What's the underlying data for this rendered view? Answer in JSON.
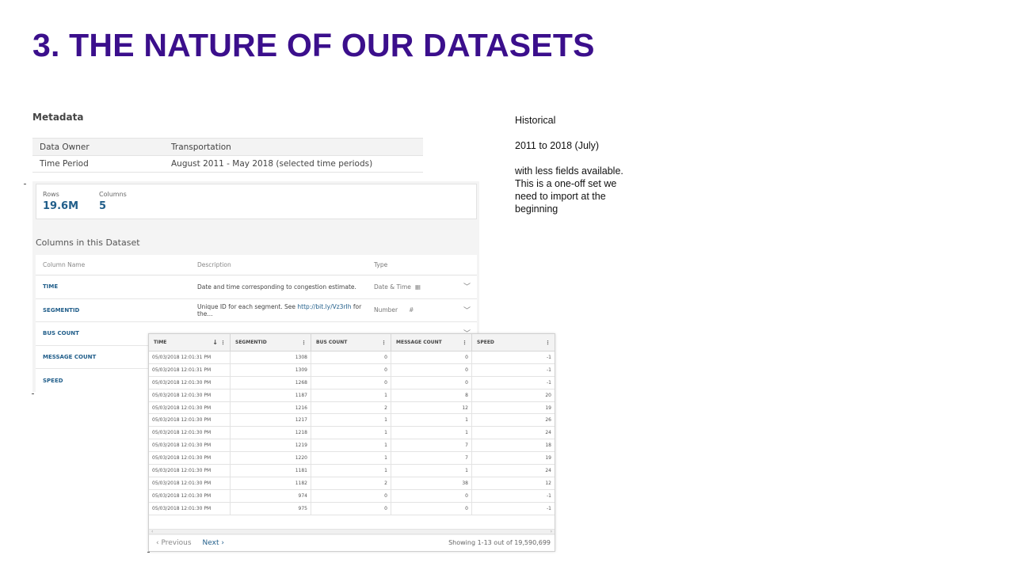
{
  "slide": {
    "title": "3. THE NATURE OF OUR DATASETS"
  },
  "notes": {
    "line1": "Historical",
    "line2": "2011 to 2018 (July)",
    "line3": "with less fields available.  This is a one-off set we need to import at the beginning"
  },
  "metadata": {
    "heading": "Metadata",
    "rows": [
      {
        "key": "Data Owner",
        "value": "Transportation"
      },
      {
        "key": "Time Period",
        "value": "August 2011 - May 2018 (selected time periods)"
      }
    ]
  },
  "stats": {
    "rows_label": "Rows",
    "rows_value": "19.6M",
    "columns_label": "Columns",
    "columns_value": "5"
  },
  "columns_section": {
    "heading": "Columns in this Dataset",
    "headers": {
      "name": "Column Name",
      "description": "Description",
      "type": "Type"
    },
    "rows": [
      {
        "name": "TIME",
        "description": "Date and time corresponding to congestion estimate.",
        "type": "Date & Time",
        "icon": "calendar-icon"
      },
      {
        "name": "SEGMENTID",
        "description_pre": "Unique ID for each segment. See ",
        "link": "http://bit.ly/Vz3rIh",
        "description_post": " for the...",
        "type": "Number",
        "icon": "hash-icon"
      },
      {
        "name": "BUS COUNT"
      },
      {
        "name": "MESSAGE COUNT"
      },
      {
        "name": "SPEED"
      }
    ]
  },
  "grid": {
    "headers": [
      "TIME",
      "SEGMENTID",
      "BUS COUNT",
      "MESSAGE COUNT",
      "SPEED"
    ],
    "rows": [
      [
        "05/03/2018 12:01:31 PM",
        "1308",
        "0",
        "0",
        "-1"
      ],
      [
        "05/03/2018 12:01:31 PM",
        "1309",
        "0",
        "0",
        "-1"
      ],
      [
        "05/03/2018 12:01:30 PM",
        "1268",
        "0",
        "0",
        "-1"
      ],
      [
        "05/03/2018 12:01:30 PM",
        "1187",
        "1",
        "8",
        "20"
      ],
      [
        "05/03/2018 12:01:30 PM",
        "1216",
        "2",
        "12",
        "19"
      ],
      [
        "05/03/2018 12:01:30 PM",
        "1217",
        "1",
        "1",
        "26"
      ],
      [
        "05/03/2018 12:01:30 PM",
        "1218",
        "1",
        "1",
        "24"
      ],
      [
        "05/03/2018 12:01:30 PM",
        "1219",
        "1",
        "7",
        "18"
      ],
      [
        "05/03/2018 12:01:30 PM",
        "1220",
        "1",
        "7",
        "19"
      ],
      [
        "05/03/2018 12:01:30 PM",
        "1181",
        "1",
        "1",
        "24"
      ],
      [
        "05/03/2018 12:01:30 PM",
        "1182",
        "2",
        "38",
        "12"
      ],
      [
        "05/03/2018 12:01:30 PM",
        "974",
        "0",
        "0",
        "-1"
      ],
      [
        "05/03/2018 12:01:30 PM",
        "975",
        "0",
        "0",
        "-1"
      ]
    ],
    "prev_label": "Previous",
    "next_label": "Next",
    "showing": "Showing 1-13 out of 19,590,699"
  },
  "colors": {
    "title": "#3b0f8c",
    "link": "#215e8a"
  }
}
